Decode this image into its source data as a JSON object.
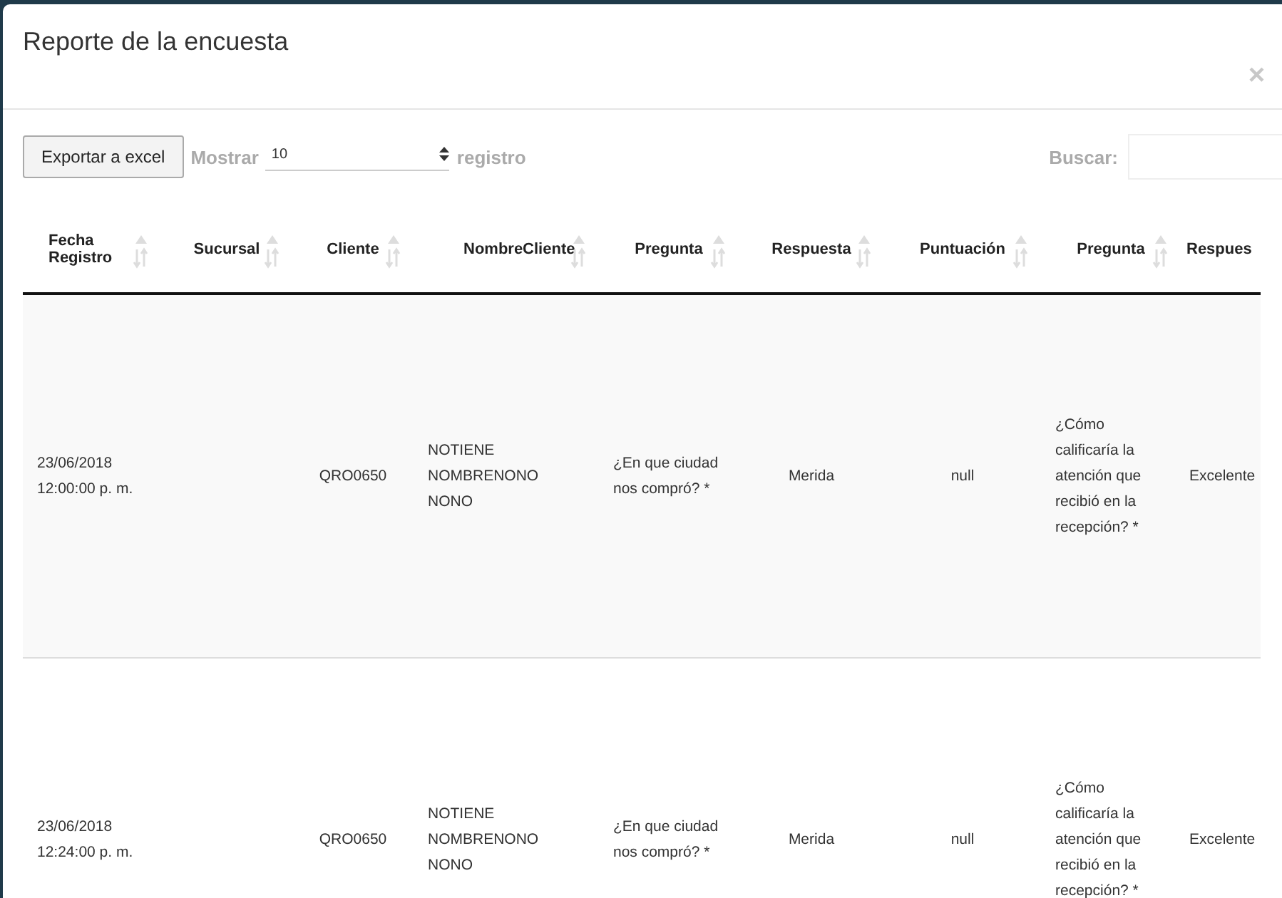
{
  "modal": {
    "title": "Reporte de la encuesta",
    "close": "×"
  },
  "toolbar": {
    "export_button": "Exportar a excel",
    "show_label": "Mostrar",
    "page_size": "10",
    "records_label": "registro",
    "search_label": "Buscar:"
  },
  "table": {
    "columns": [
      "Fecha Registro",
      "Sucursal",
      "Cliente",
      "NombreCliente",
      "Pregunta",
      "Respuesta",
      "Puntuación",
      "Pregunta",
      "Respues"
    ],
    "rows": [
      {
        "cells": [
          "23/06/2018 12:00:00 p. m.",
          "",
          "QRO0650",
          "NOTIENE NOMBRENONO NONO",
          "¿En que ciudad nos compró? *",
          "Merida",
          "null",
          "¿Cómo calificaría la atención que recibió en la recepción? *",
          "Excelente"
        ]
      },
      {
        "cells": [
          "23/06/2018 12:24:00 p. m.",
          "",
          "QRO0650",
          "NOTIENE NOMBRENONO NONO",
          "¿En que ciudad nos compró? *",
          "Merida",
          "null",
          "¿Cómo calificaría la atención que recibió en la recepción? *",
          "Excelente"
        ]
      }
    ]
  }
}
